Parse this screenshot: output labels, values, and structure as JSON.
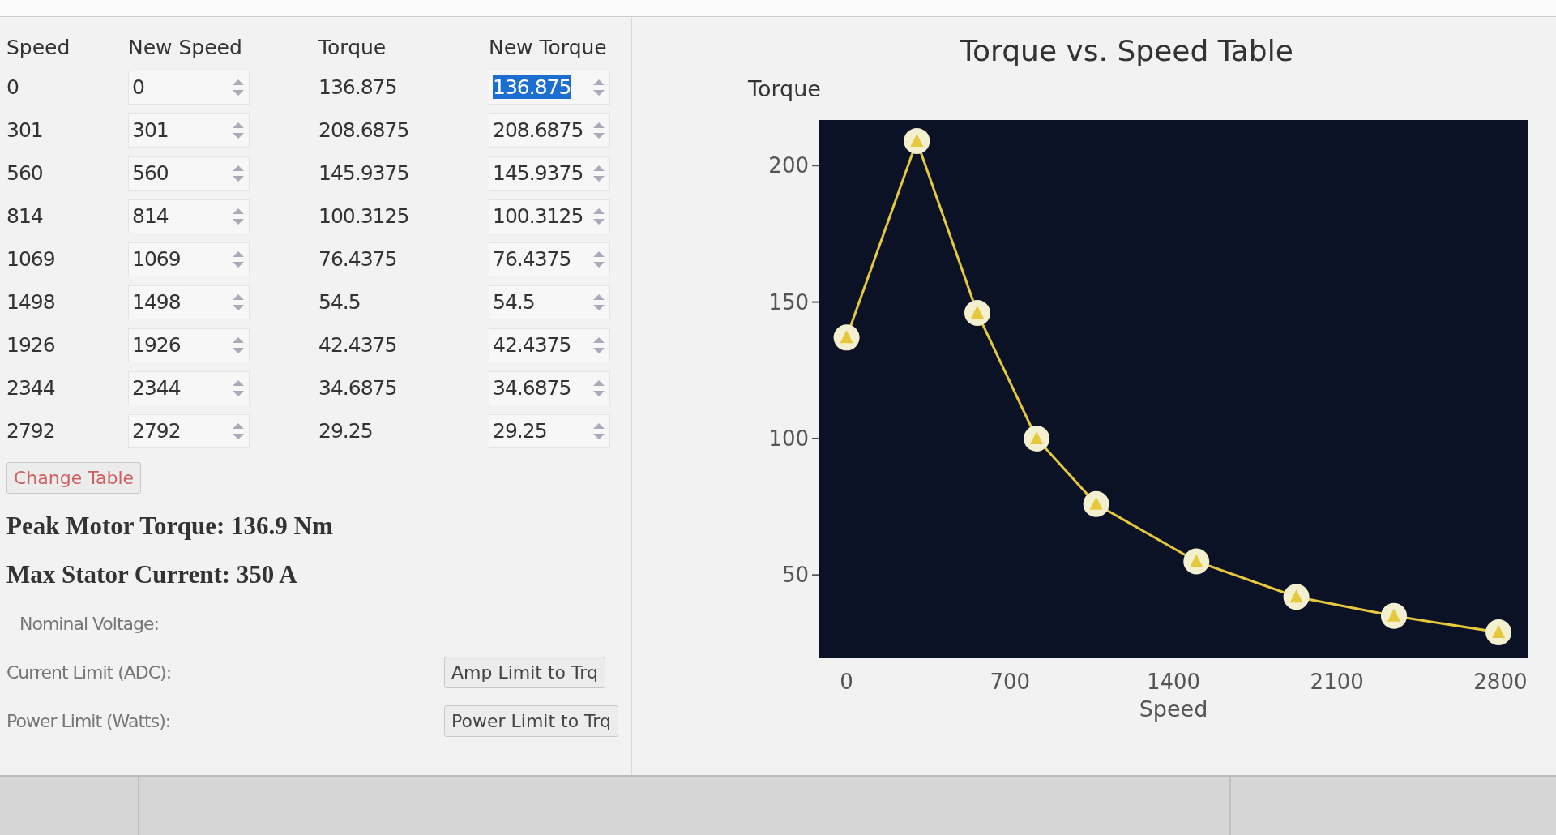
{
  "table": {
    "columns": [
      "Speed",
      "New Speed",
      "Torque",
      "New Torque"
    ],
    "rows": [
      {
        "speed": "0",
        "new_speed": "0",
        "torque": "136.875",
        "new_torque": "136.875",
        "highlighted": true
      },
      {
        "speed": "301",
        "new_speed": "301",
        "torque": "208.6875",
        "new_torque": "208.6875",
        "highlighted": false
      },
      {
        "speed": "560",
        "new_speed": "560",
        "torque": "145.9375",
        "new_torque": "145.9375",
        "highlighted": false
      },
      {
        "speed": "814",
        "new_speed": "814",
        "torque": "100.3125",
        "new_torque": "100.3125",
        "highlighted": false
      },
      {
        "speed": "1069",
        "new_speed": "1069",
        "torque": "76.4375",
        "new_torque": "76.4375",
        "highlighted": false
      },
      {
        "speed": "1498",
        "new_speed": "1498",
        "torque": "54.5",
        "new_torque": "54.5",
        "highlighted": false
      },
      {
        "speed": "1926",
        "new_speed": "1926",
        "torque": "42.4375",
        "new_torque": "42.4375",
        "highlighted": false
      },
      {
        "speed": "2344",
        "new_speed": "2344",
        "torque": "34.6875",
        "new_torque": "34.6875",
        "highlighted": false
      },
      {
        "speed": "2792",
        "new_speed": "2792",
        "torque": "29.25",
        "new_torque": "29.25",
        "highlighted": false
      }
    ]
  },
  "change_button": "Change Table",
  "peak_torque": "Peak Motor Torque: 136.9 Nm",
  "max_current": "Max Stator Current: 350 A",
  "limits": [
    {
      "label": "Nominal Voltage:"
    },
    {
      "label": "Current Limit (ADC):",
      "button": "Amp Limit to Trq"
    },
    {
      "label": "Power Limit (Watts):",
      "button": "Power Limit to Trq"
    }
  ],
  "chart": {
    "chart_data": {
      "type": "line",
      "title": "Torque vs. Speed Table",
      "xlabel": "Speed",
      "ylabel": "Torque",
      "x": [
        0,
        301,
        560,
        814,
        1069,
        1498,
        1926,
        2344,
        2792
      ],
      "series": [
        {
          "color": "#e6c83c",
          "marker": "triangle",
          "values": [
            137,
            209,
            146,
            100,
            76,
            55,
            42,
            35,
            29
          ]
        }
      ],
      "xlim": [
        -120,
        2920
      ],
      "ylim": [
        19.5,
        216.7
      ],
      "xticks": [
        0,
        700,
        1400,
        2100,
        2800
      ],
      "yticks": [
        50,
        100,
        150,
        200
      ]
    }
  }
}
